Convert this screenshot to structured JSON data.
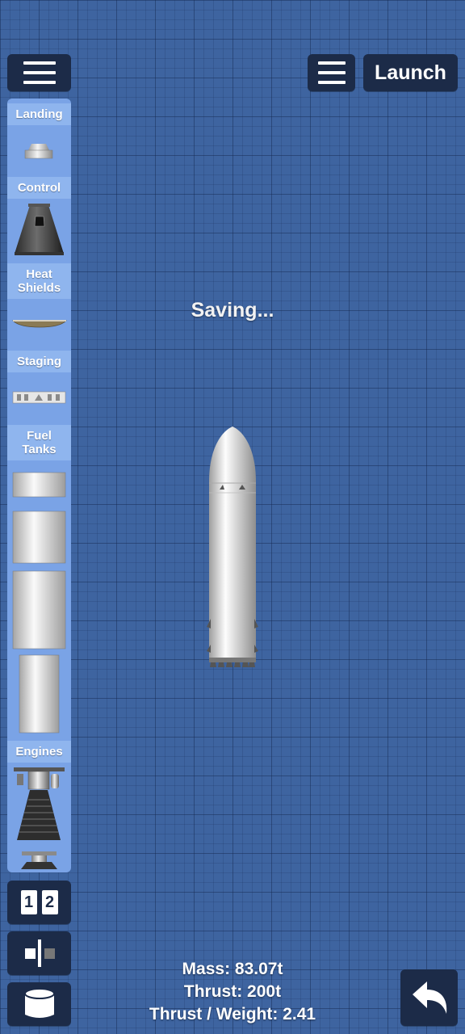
{
  "toolbar": {
    "menu_icon": "hamburger-icon",
    "launch_label": "Launch"
  },
  "palette": {
    "categories": [
      {
        "label": "Landing"
      },
      {
        "label": "Control"
      },
      {
        "label": "Heat\nShields"
      },
      {
        "label": "Staging"
      },
      {
        "label": "Fuel\nTanks"
      },
      {
        "label": "Engines"
      }
    ]
  },
  "status": {
    "message": "Saving..."
  },
  "stats": {
    "mass": "Mass: 83.07t",
    "thrust": "Thrust: 200t",
    "twr": "Thrust / Weight: 2.41"
  },
  "side_buttons": {
    "stage_1": "1",
    "stage_2": "2"
  },
  "colors": {
    "background": "#3e64a0",
    "button": "#1c2b48",
    "palette": "#7aa3e6",
    "category_header": "#8fb5ee"
  }
}
